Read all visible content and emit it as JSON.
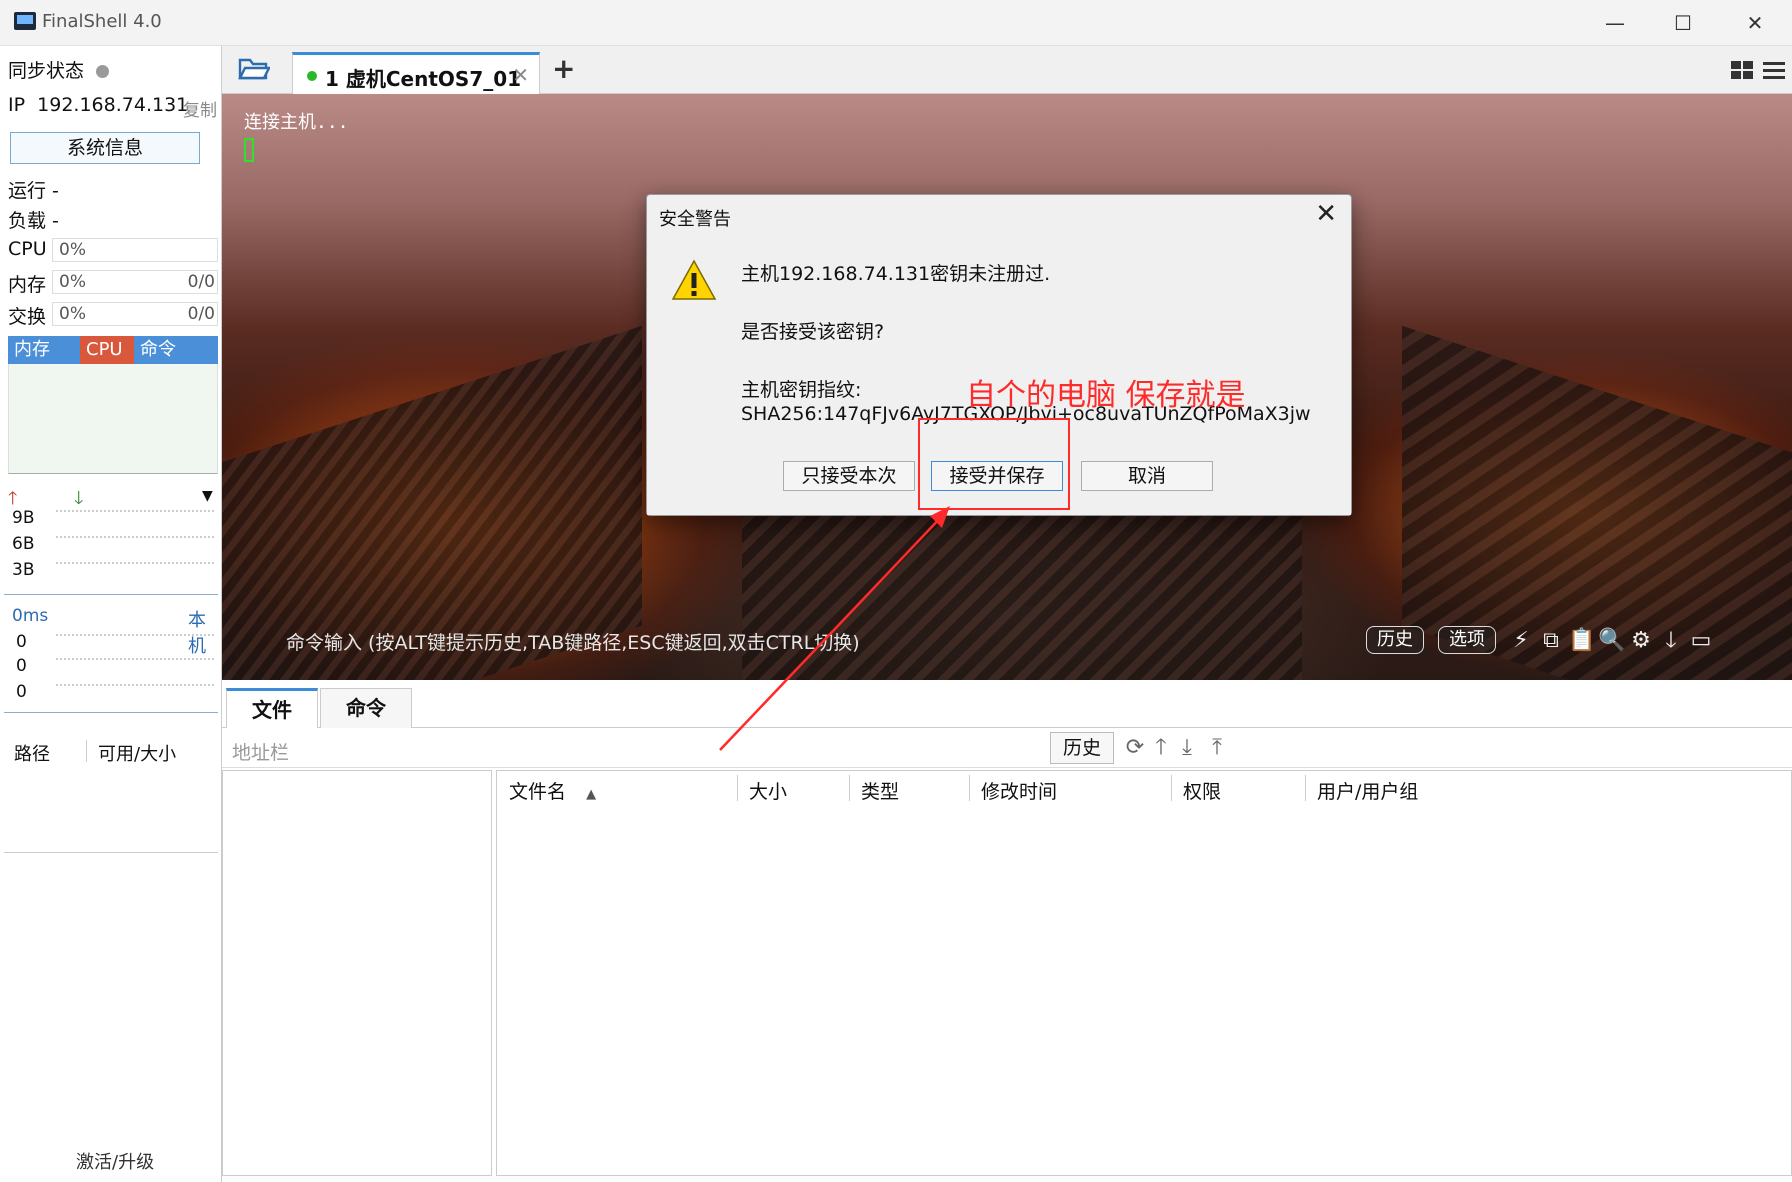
{
  "window": {
    "title": "FinalShell 4.0",
    "minimize_glyph": "—",
    "maximize_glyph": "☐",
    "close_glyph": "✕"
  },
  "sidebar": {
    "sync_label": "同步状态",
    "ip_label": "IP",
    "ip_value": "192.168.74.131",
    "copy_label": "复制",
    "sysinfo_button": "系统信息",
    "run_label": "运行 -",
    "load_label": "负载 -",
    "cpu": {
      "label": "CPU",
      "value": "0%"
    },
    "mem": {
      "label": "内存",
      "value": "0%",
      "right": "0/0"
    },
    "swap": {
      "label": "交换",
      "value": "0%",
      "right": "0/0"
    },
    "mini_tabs": [
      {
        "label": "内存",
        "color": "#4a8fd8"
      },
      {
        "label": "CPU",
        "color": "#d9583b"
      },
      {
        "label": "命令",
        "color": "#4a8fd8"
      }
    ],
    "net": {
      "up_glyph": "🡑",
      "down_glyph": "🡓",
      "dropdown_glyph": "▼",
      "ticks": [
        "9B",
        "6B",
        "3B"
      ]
    },
    "latency": {
      "value": "0ms",
      "host_label": "本机",
      "ticks": [
        "0",
        "0",
        "0"
      ]
    },
    "disk_headers": [
      "路径",
      "可用/大小"
    ],
    "activate_label": "激活/升级"
  },
  "session_tabs": [
    {
      "label": "1 虚机CentOS7_01",
      "close_glyph": "✕",
      "status_color": "#28b828"
    }
  ],
  "add_tab_glyph": "+",
  "terminal": {
    "output": "连接主机...",
    "command_hint": "命令输入 (按ALT键提示历史,TAB键路径,ESC键返回,双击CTRL切换)",
    "history_button": "历史",
    "options_button": "选项",
    "icons": [
      {
        "name": "lightning-icon",
        "glyph": "⚡"
      },
      {
        "name": "copy-icon",
        "glyph": "⧉"
      },
      {
        "name": "paste-icon",
        "glyph": "📋"
      },
      {
        "name": "search-icon",
        "glyph": "🔍"
      },
      {
        "name": "gear-icon",
        "glyph": "⚙"
      },
      {
        "name": "arrow-down-icon",
        "glyph": "🡓"
      },
      {
        "name": "window-icon",
        "glyph": "▭"
      }
    ]
  },
  "file_panel": {
    "tabs": [
      "文件",
      "命令"
    ],
    "address_placeholder": "地址栏",
    "history_button": "历史",
    "tool_icons": [
      {
        "name": "refresh-icon",
        "glyph": "⟳"
      },
      {
        "name": "up-dir-icon",
        "glyph": "🡑"
      },
      {
        "name": "download-icon",
        "glyph": "⤓"
      },
      {
        "name": "upload-icon",
        "glyph": "⤒"
      }
    ],
    "columns": [
      "文件名",
      "大小",
      "类型",
      "修改时间",
      "权限",
      "用户/用户组"
    ],
    "sort_glyph": "▲"
  },
  "dialog": {
    "title": "安全警告",
    "close_glyph": "✕",
    "line1": "主机192.168.74.131密钥未注册过.",
    "line2": "是否接受该密钥?",
    "line3": "主机密钥指纹:",
    "fingerprint": "SHA256:147qFJv6AyJ7TGXOP/Jbvi+oc8uvaTUnZQfPoMaX3jw",
    "buttons": [
      "只接受本次",
      "接受并保存",
      "取消"
    ]
  },
  "annotation": {
    "text": "自个的电脑 保存就是",
    "color": "#ff2a2a"
  }
}
